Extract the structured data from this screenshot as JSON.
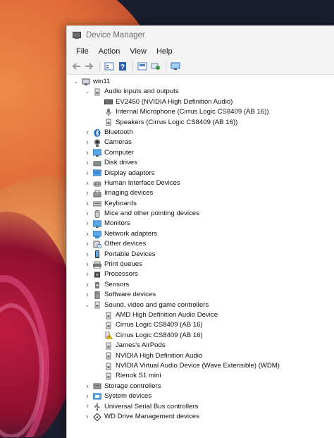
{
  "window": {
    "title": "Device Manager"
  },
  "menu": [
    "File",
    "Action",
    "View",
    "Help"
  ],
  "toolbar": [
    {
      "icon": "back-arrow-icon",
      "color": "#9a9a9a"
    },
    {
      "icon": "forward-arrow-icon",
      "color": "#9a9a9a"
    },
    {
      "icon": "properties-icon",
      "color": "#4a7bc8"
    },
    {
      "icon": "help-icon",
      "color": "#2f5fb0"
    },
    {
      "icon": "update-driver-icon",
      "color": "#4a7bc8"
    },
    {
      "icon": "scan-hardware-icon",
      "color": "#3a9a4a"
    },
    {
      "icon": "display-icon",
      "color": "#2f6fb8"
    }
  ],
  "tree": {
    "root": "win11",
    "nodes": [
      {
        "label": "Audio inputs and outputs",
        "icon": "speaker-icon",
        "expanded": true,
        "children": [
          {
            "label": "EV2450 (NVIDIA High Definition Audio)",
            "icon": "monitor-audio-icon"
          },
          {
            "label": "Internal Microphone (Cirrus Logic CS8409 (AB 16))",
            "icon": "microphone-icon"
          },
          {
            "label": "Speakers (Cirrus Logic CS8409 (AB 16))",
            "icon": "speaker-icon"
          }
        ]
      },
      {
        "label": "Bluetooth",
        "icon": "bluetooth-icon"
      },
      {
        "label": "Cameras",
        "icon": "camera-icon"
      },
      {
        "label": "Computer",
        "icon": "computer-icon"
      },
      {
        "label": "Disk drives",
        "icon": "disk-icon"
      },
      {
        "label": "Display adaptors",
        "icon": "display-adapter-icon"
      },
      {
        "label": "Human Interface Devices",
        "icon": "hid-icon"
      },
      {
        "label": "Imaging devices",
        "icon": "imaging-icon"
      },
      {
        "label": "Keyboards",
        "icon": "keyboard-icon"
      },
      {
        "label": "Mice and other pointing devices",
        "icon": "mouse-icon"
      },
      {
        "label": "Monitors",
        "icon": "monitor-icon"
      },
      {
        "label": "Network adapters",
        "icon": "network-icon"
      },
      {
        "label": "Other devices",
        "icon": "other-device-icon"
      },
      {
        "label": "Portable Devices",
        "icon": "portable-icon"
      },
      {
        "label": "Print queues",
        "icon": "printer-icon"
      },
      {
        "label": "Processors",
        "icon": "processor-icon"
      },
      {
        "label": "Sensors",
        "icon": "sensor-icon"
      },
      {
        "label": "Software devices",
        "icon": "software-device-icon"
      },
      {
        "label": "Sound, video and game controllers",
        "icon": "speaker-icon",
        "expanded": true,
        "children": [
          {
            "label": "AMD High Definition Audio Device",
            "icon": "speaker-icon"
          },
          {
            "label": "Cirrus Logic CS8409 (AB 16)",
            "icon": "speaker-icon"
          },
          {
            "label": "Cirrus Logic CS8409 (AB 16)",
            "icon": "speaker-warning-icon"
          },
          {
            "label": "James's AirPods",
            "icon": "speaker-icon"
          },
          {
            "label": "NVIDIA High Definition Audio",
            "icon": "speaker-icon"
          },
          {
            "label": "NVIDIA Virtual Audio Device (Wave Extensible) (WDM)",
            "icon": "speaker-icon"
          },
          {
            "label": "Rienok S1 mini",
            "icon": "speaker-icon"
          }
        ]
      },
      {
        "label": "Storage controllers",
        "icon": "storage-icon"
      },
      {
        "label": "System devices",
        "icon": "system-icon"
      },
      {
        "label": "Universal Serial Bus controllers",
        "icon": "usb-icon"
      },
      {
        "label": "WD Drive Management devices",
        "icon": "wd-icon"
      }
    ]
  }
}
